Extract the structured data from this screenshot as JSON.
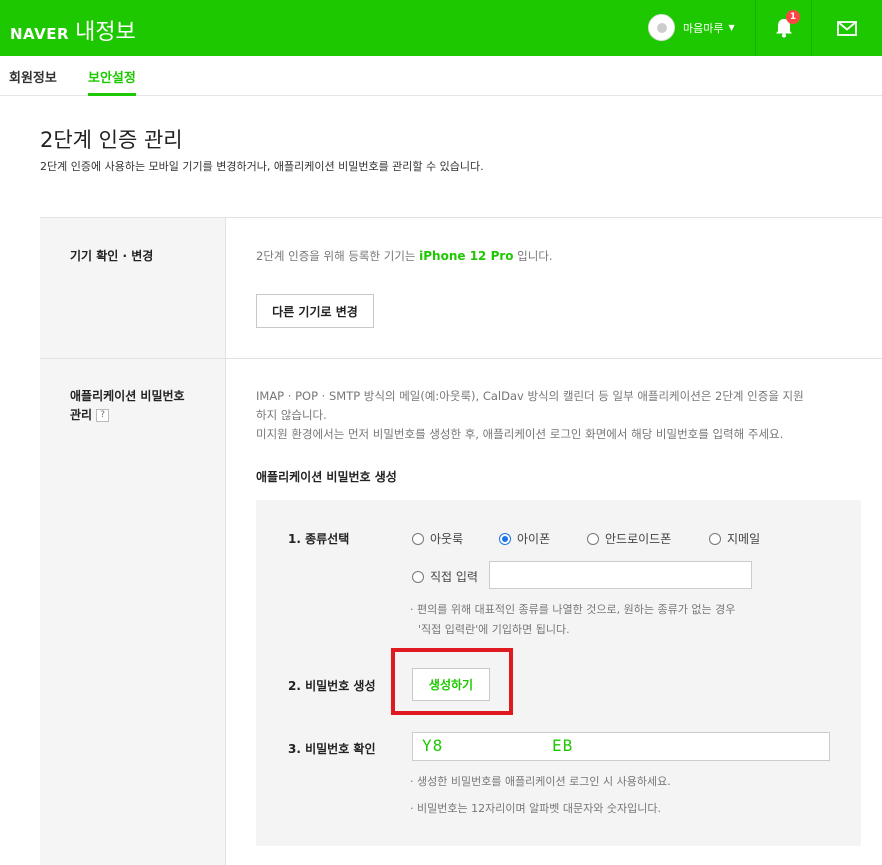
{
  "header": {
    "brand": "NAVER",
    "service": "내정보",
    "user_name": "마음마루",
    "notification_count": "1",
    "colors": {
      "brand_green": "#1ec800",
      "alert_red": "#e0181f"
    },
    "icons": [
      "bell-icon",
      "mail-icon",
      "chevron-down-icon"
    ]
  },
  "tabs": [
    {
      "label": "회원정보"
    },
    {
      "label": "보안설정"
    }
  ],
  "page": {
    "title": "2단계 인증 관리",
    "description": "2단계 인증에 사용하는 모바일 기기를 변경하거나, 애플리케이션 비밀번호를 관리할 수 있습니다."
  },
  "device_section": {
    "label": "기기 확인 · 변경",
    "text_before": "2단계 인증을 위해 등록한 기기는 ",
    "device_name": "iPhone 12 Pro",
    "text_after": " 입니다.",
    "change_button": "다른 기기로 변경"
  },
  "app_password_section": {
    "label_line1": "애플리케이션 비밀번호",
    "label_line2": "관리",
    "help_icon": "?",
    "desc_line1": "IMAP · POP · SMTP 방식의 메일(예:아웃룩), CalDav 방식의 캘린더 등 일부 애플리케이션은 2단계 인증을 지원",
    "desc_line2": "하지 않습니다.",
    "desc_line3": "미지원 환경에서는 먼저 비밀번호를 생성한 후, 애플리케이션 로그인 화면에서 해당 비밀번호를 입력해 주세요.",
    "sub_title": "애플리케이션 비밀번호 생성",
    "step1_label": "1. 종류선택",
    "options": [
      {
        "label": "아웃룩",
        "checked": false
      },
      {
        "label": "아이폰",
        "checked": true
      },
      {
        "label": "안드로이드폰",
        "checked": false
      },
      {
        "label": "지메일",
        "checked": false
      },
      {
        "label": "직접 입력",
        "checked": false
      }
    ],
    "note1_line1": "· 편의를 위해 대표적인 종류를 나열한 것으로, 원하는 종류가 없는 경우",
    "note1_line2": "'직접 입력란'에 기입하면 됩니다.",
    "step2_label": "2. 비밀번호 생성",
    "generate_button": "생성하기",
    "step3_label": "3. 비밀번호 확인",
    "password_visible_start": "Y8",
    "password_visible_end": "EB",
    "note2": "· 생성한 비밀번호를 애플리케이션 로그인 시 사용하세요.",
    "note3": "· 비밀번호는 12자리이며 알파벳 대문자와 숫자입니다."
  }
}
